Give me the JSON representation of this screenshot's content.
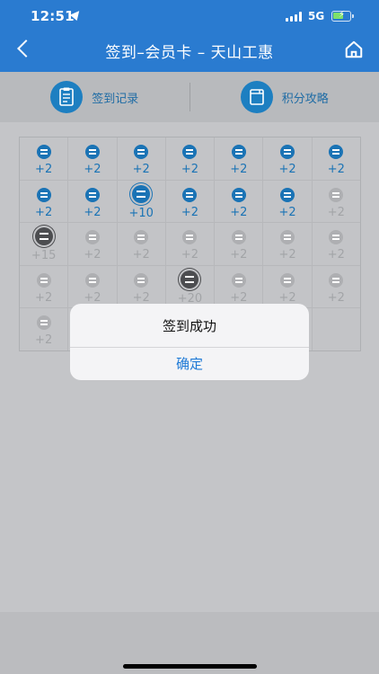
{
  "status": {
    "time": "12:51",
    "network": "5G"
  },
  "nav": {
    "title": "签到–会员卡 – 天山工惠"
  },
  "menu": [
    {
      "label": "签到记录",
      "icon": "clipboard-icon"
    },
    {
      "label": "积分攻略",
      "icon": "book-icon"
    }
  ],
  "grid": [
    [
      {
        "pts": "+2",
        "state": "done"
      },
      {
        "pts": "+2",
        "state": "done"
      },
      {
        "pts": "+2",
        "state": "done"
      },
      {
        "pts": "+2",
        "state": "done"
      },
      {
        "pts": "+2",
        "state": "done"
      },
      {
        "pts": "+2",
        "state": "done"
      },
      {
        "pts": "+2",
        "state": "done"
      }
    ],
    [
      {
        "pts": "+2",
        "state": "done"
      },
      {
        "pts": "+2",
        "state": "done"
      },
      {
        "pts": "+10",
        "state": "done-bonus"
      },
      {
        "pts": "+2",
        "state": "done"
      },
      {
        "pts": "+2",
        "state": "done"
      },
      {
        "pts": "+2",
        "state": "done"
      },
      {
        "pts": "+2",
        "state": "pending"
      }
    ],
    [
      {
        "pts": "+15",
        "state": "pending-bonus"
      },
      {
        "pts": "+2",
        "state": "pending"
      },
      {
        "pts": "+2",
        "state": "pending"
      },
      {
        "pts": "+2",
        "state": "pending"
      },
      {
        "pts": "+2",
        "state": "pending"
      },
      {
        "pts": "+2",
        "state": "pending"
      },
      {
        "pts": "+2",
        "state": "pending"
      }
    ],
    [
      {
        "pts": "+2",
        "state": "pending"
      },
      {
        "pts": "+2",
        "state": "pending"
      },
      {
        "pts": "+2",
        "state": "pending"
      },
      {
        "pts": "+20",
        "state": "pending-bonus"
      },
      {
        "pts": "+2",
        "state": "pending"
      },
      {
        "pts": "+2",
        "state": "pending"
      },
      {
        "pts": "+2",
        "state": "pending"
      }
    ],
    [
      {
        "pts": "+2",
        "state": "pending"
      }
    ]
  ],
  "dialog": {
    "title": "签到成功",
    "confirm": "确定"
  },
  "colors": {
    "header": "#2a7bd0",
    "accent": "#1a73b5",
    "overlay": "#c4c5c8"
  }
}
